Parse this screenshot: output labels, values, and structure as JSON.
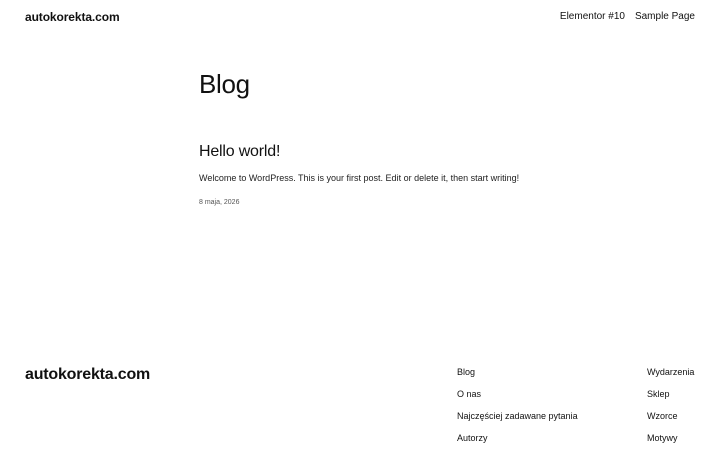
{
  "header": {
    "site_title": "autokorekta.com",
    "nav": [
      "Elementor #10",
      "Sample Page"
    ]
  },
  "main": {
    "page_title": "Blog",
    "post": {
      "title": "Hello world!",
      "excerpt": "Welcome to WordPress. This is your first post. Edit or delete it, then start writing!",
      "date": "8 maja, 2026"
    }
  },
  "footer": {
    "site_title": "autokorekta.com",
    "col1": [
      "Blog",
      "O nas",
      "Najczęściej zadawane pytania",
      "Autorzy"
    ],
    "col2": [
      "Wydarzenia",
      "Sklep",
      "Wzorce",
      "Motywy"
    ]
  }
}
